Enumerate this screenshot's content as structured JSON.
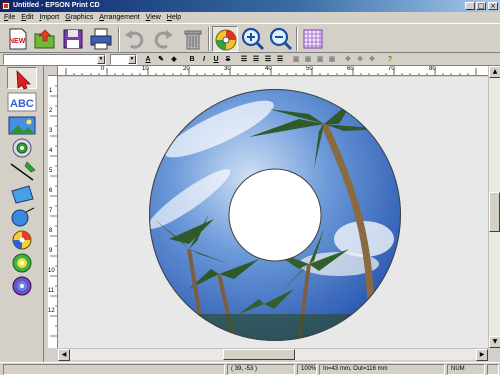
{
  "window": {
    "title": "Untitled - EPSON Print CD"
  },
  "menu": [
    {
      "label": "File",
      "key": "F",
      "rest": "ile"
    },
    {
      "label": "Edit",
      "key": "E",
      "rest": "dit"
    },
    {
      "label": "Import",
      "key": "I",
      "rest": "mport"
    },
    {
      "label": "Graphics",
      "key": "G",
      "rest": "raphics"
    },
    {
      "label": "Arrangement",
      "key": "A",
      "rest": "rrangement"
    },
    {
      "label": "View",
      "key": "V",
      "rest": "iew"
    },
    {
      "label": "Help",
      "key": "H",
      "rest": "elp"
    }
  ],
  "toolbar": {
    "new_label": "NEW",
    "buttons": [
      "new-document",
      "open-background",
      "save",
      "print",
      "undo",
      "redo",
      "delete",
      "disc-layout",
      "zoom-in",
      "zoom-out",
      "grid"
    ]
  },
  "format": {
    "font_value": "",
    "size_value": "",
    "text_color_glyph": "A",
    "bold": "B",
    "italic": "I",
    "underline": "U",
    "strike": "S"
  },
  "palette": {
    "text_tool_label": "ABC",
    "tools": [
      "select",
      "text",
      "image",
      "disc-text",
      "line",
      "rectangle",
      "ellipse",
      "circular-text",
      "disc-print-1",
      "disc-print-2",
      "disc-print-3"
    ]
  },
  "rulers": {
    "h_labels": [
      "0",
      "10",
      "20",
      "30",
      "40",
      "50",
      "60",
      "70",
      "80"
    ],
    "v_labels": [
      "1",
      "2",
      "3",
      "4",
      "5",
      "6",
      "7",
      "8",
      "9",
      "10",
      "11",
      "12"
    ]
  },
  "status": {
    "coords": "( 39, -53 )",
    "zoom": "100%",
    "disc_size": "In=43 mm, Out=116 mm",
    "num": "NUM"
  },
  "colors": {
    "titlebar_start": "#0a246a",
    "sky": "#4a7fd0",
    "canvas": "#e8e8e8"
  }
}
